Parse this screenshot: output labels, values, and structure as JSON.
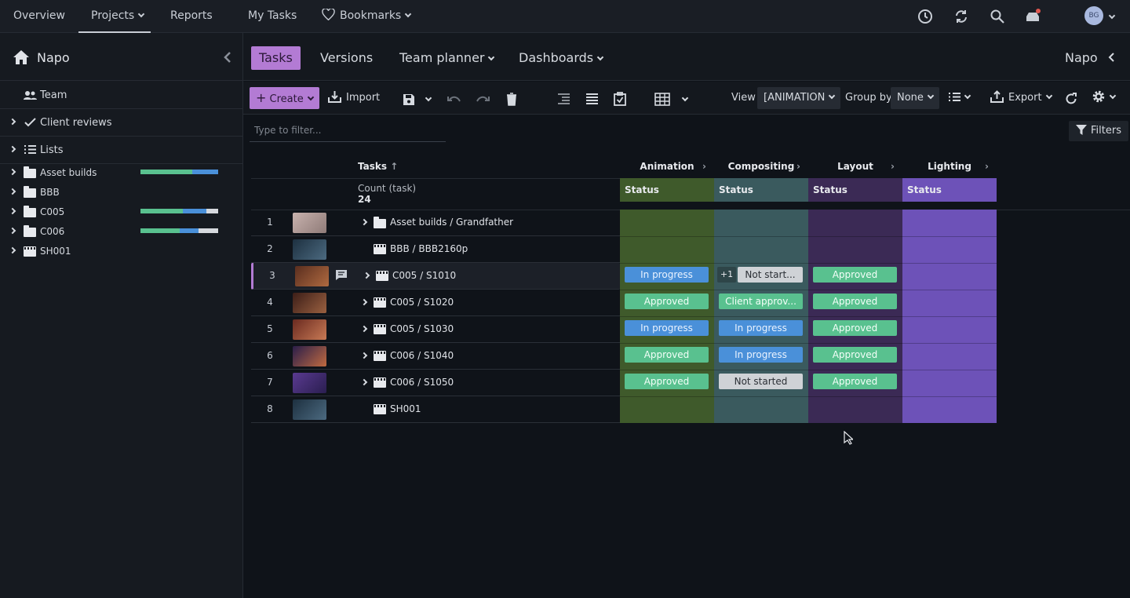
{
  "topnav": {
    "items": [
      "Overview",
      "Projects",
      "Reports",
      "My Tasks",
      "Bookmarks"
    ],
    "avatar_initials": "BG"
  },
  "sidebar": {
    "project": "Napo",
    "team": "Team",
    "client_reviews": "Client reviews",
    "lists": "Lists",
    "tree": [
      {
        "label": "Asset builds",
        "progress": [
          0.67,
          0.33,
          0
        ]
      },
      {
        "label": "BBB"
      },
      {
        "label": "C005",
        "progress": [
          0.55,
          0.3,
          0.15
        ]
      },
      {
        "label": "C006",
        "progress": [
          0.5,
          0.25,
          0.25
        ]
      },
      {
        "label": "SH001"
      }
    ]
  },
  "tabs": [
    "Tasks",
    "Versions",
    "Team planner",
    "Dashboards"
  ],
  "project_right": "Napo",
  "toolbar": {
    "create": "Create",
    "import": "Import",
    "view_label": "View",
    "view_value": "[ANIMATION",
    "groupby_label": "Group by",
    "groupby_value": "None",
    "export": "Export"
  },
  "filter": {
    "placeholder": "Type to filter...",
    "filters_btn": "Filters"
  },
  "grid": {
    "tasks_header": "Tasks",
    "count_label": "Count (task)",
    "count_value": "24",
    "columns": [
      "Animation",
      "Compositing",
      "Layout",
      "Lighting"
    ],
    "status_label": "Status",
    "colors": {
      "animation": "#3f5a2b",
      "compositing": "#3a5a5e",
      "layout": "#3b2a55",
      "lighting": "#6d52b8"
    },
    "rows": [
      {
        "n": "1",
        "label": "Asset builds / Grandfather",
        "cells": [
          "",
          "",
          "",
          ""
        ]
      },
      {
        "n": "2",
        "label": "BBB / BBB2160p",
        "cells": [
          "",
          "",
          "",
          ""
        ]
      },
      {
        "n": "3",
        "label": "C005 / S1010",
        "cells": [
          "In progress",
          "Not start...",
          "Approved",
          ""
        ],
        "extra": "+1"
      },
      {
        "n": "4",
        "label": "C005 / S1020",
        "cells": [
          "Approved",
          "Client approv...",
          "Approved",
          ""
        ]
      },
      {
        "n": "5",
        "label": "C005 / S1030",
        "cells": [
          "In progress",
          "In progress",
          "Approved",
          ""
        ]
      },
      {
        "n": "6",
        "label": "C006 / S1040",
        "cells": [
          "Approved",
          "In progress",
          "Approved",
          ""
        ]
      },
      {
        "n": "7",
        "label": "C006 / S1050",
        "cells": [
          "Approved",
          "Not started",
          "Approved",
          ""
        ]
      },
      {
        "n": "8",
        "label": "SH001",
        "cells": [
          "",
          "",
          "",
          ""
        ]
      }
    ]
  }
}
